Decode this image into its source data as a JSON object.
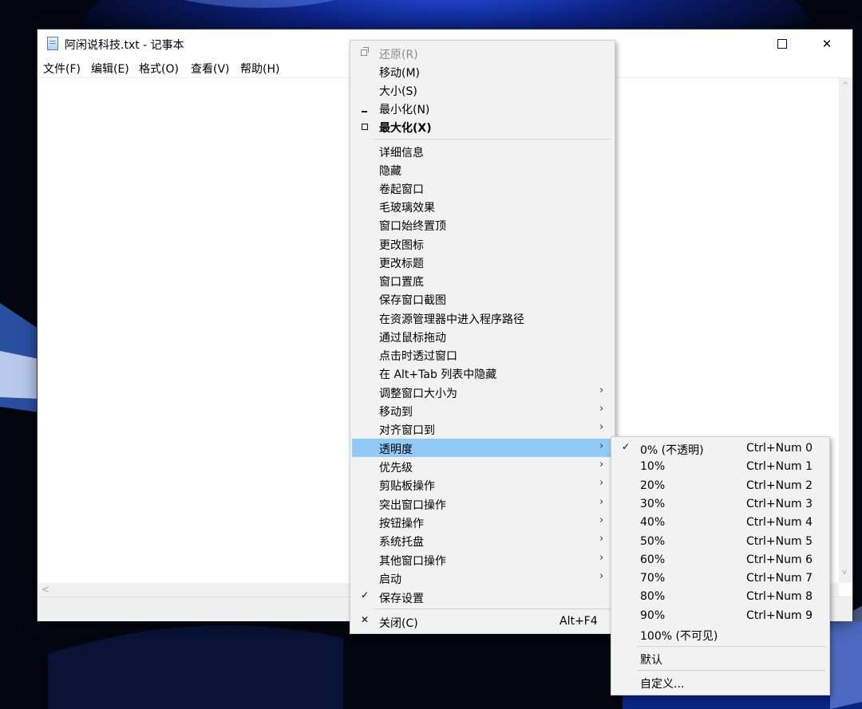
{
  "window": {
    "title": "阿闲说科技.txt - 记事本",
    "minimize_glyph": "—",
    "close_glyph": "✕",
    "menubar": [
      "文件(F)",
      "编辑(E)",
      "格式(O)",
      "查看(V)",
      "帮助(H)"
    ],
    "hscroll_left_arrow": "<",
    "vscroll_up_arrow": "^",
    "vscroll_down_arrow": "v"
  },
  "context_menu": {
    "restore": "还原(R)",
    "move": "移动(M)",
    "size": "大小(S)",
    "minimize": "最小化(N)",
    "maximize": "最大化(X)",
    "items": [
      "详细信息",
      "隐藏",
      "卷起窗口",
      "毛玻璃效果",
      "窗口始终置顶",
      "更改图标",
      "更改标题",
      "窗口置底",
      "保存窗口截图",
      "在资源管理器中进入程序路径",
      "通过鼠标拖动",
      "点击时透过窗口",
      "在 Alt+Tab 列表中隐藏"
    ],
    "submenus": [
      "调整窗口大小为",
      "移动到",
      "对齐窗口到",
      "透明度",
      "优先级",
      "剪贴板操作",
      "突出窗口操作",
      "按钮操作",
      "系统托盘",
      "其他窗口操作",
      "启动"
    ],
    "save_settings": "保存设置",
    "close": "关闭(C)",
    "close_shortcut": "Alt+F4",
    "arrow_glyph": "›",
    "check_glyph": "✓",
    "close_glyph": "✕"
  },
  "transparency_menu": {
    "items": [
      {
        "label": "0% (不透明)",
        "shortcut": "Ctrl+Num 0",
        "checked": true
      },
      {
        "label": "10%",
        "shortcut": "Ctrl+Num 1"
      },
      {
        "label": "20%",
        "shortcut": "Ctrl+Num 2"
      },
      {
        "label": "30%",
        "shortcut": "Ctrl+Num 3"
      },
      {
        "label": "40%",
        "shortcut": "Ctrl+Num 4"
      },
      {
        "label": "50%",
        "shortcut": "Ctrl+Num 5"
      },
      {
        "label": "60%",
        "shortcut": "Ctrl+Num 6"
      },
      {
        "label": "70%",
        "shortcut": "Ctrl+Num 7"
      },
      {
        "label": "80%",
        "shortcut": "Ctrl+Num 8"
      },
      {
        "label": "90%",
        "shortcut": "Ctrl+Num 9"
      },
      {
        "label": "100% (不可见)",
        "shortcut": ""
      }
    ],
    "default": "默认",
    "custom": "自定义..."
  },
  "colors": {
    "highlight": "#91c9f7",
    "menu_bg": "#f2f2f2",
    "wallpaper_blue": "#1f4fd6"
  }
}
